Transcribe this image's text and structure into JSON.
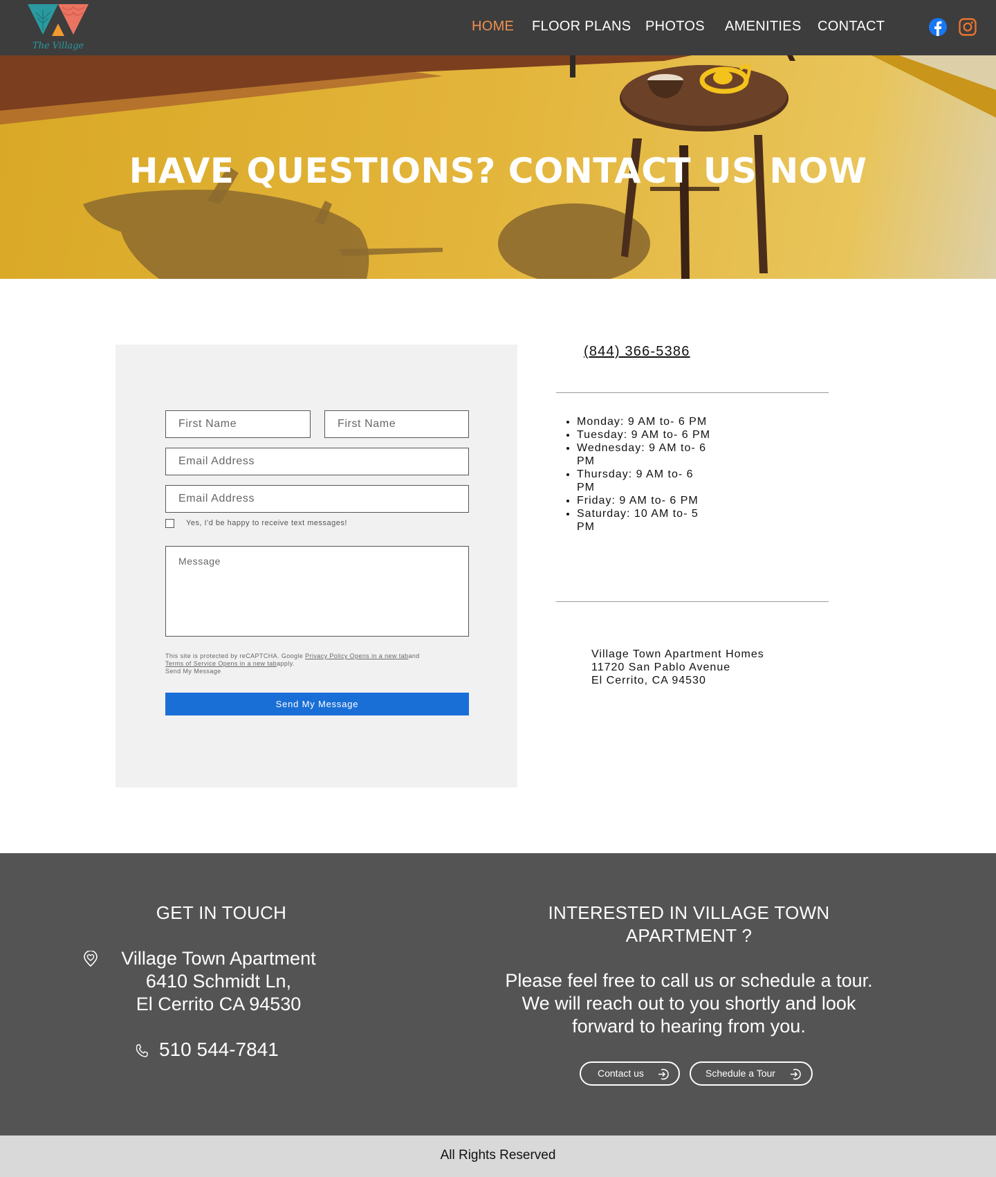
{
  "nav": {
    "logo_text": "The Village",
    "items": [
      {
        "label": "HOME",
        "active": true
      },
      {
        "label": "FLOOR PLANS"
      },
      {
        "label": "PHOTOS"
      },
      {
        "label": "AMENITIES"
      },
      {
        "label": "CONTACT"
      }
    ],
    "social": [
      "facebook-icon",
      "instagram-icon"
    ]
  },
  "hero": {
    "title": "HAVE QUESTIONS? CONTACT US NOW"
  },
  "form": {
    "first_name_placeholder": "First Name",
    "last_name_placeholder": "First Name",
    "email_placeholder": "Email Address",
    "email2_placeholder": "Email Address",
    "checkbox_label": "Yes, I'd be happy to receive text messages!",
    "message_placeholder": "Message",
    "legal_prefix": "This site is protected by reCAPTCHA. Google ",
    "legal_privacy": "Privacy Policy Opens in a new tab",
    "legal_and": "and ",
    "legal_terms": "Terms of Service Opens in a new tab",
    "legal_suffix": "apply.",
    "legal_send": "Send My Message",
    "submit_label": "Send My Message"
  },
  "contact": {
    "phone": "(844) 366-5386",
    "hours": [
      "Monday: 9 AM to- 6 PM",
      "Tuesday: 9 AM to- 6 PM",
      "Wednesday: 9 AM to- 6 PM",
      "Thursday: 9 AM to- 6 PM",
      "Friday: 9 AM to- 6 PM",
      "Saturday: 10 AM to- 5 PM"
    ],
    "address_lines": [
      "Village Town Apartment Homes",
      "11720 San Pablo Avenue",
      "El Cerrito, CA 94530"
    ]
  },
  "footer": {
    "left_heading": "GET IN TOUCH",
    "address_lines": [
      "Village Town Apartment",
      "6410 Schmidt Ln,",
      "El Cerrito CA 94530"
    ],
    "phone": "510 544-7841",
    "right_heading": "INTERESTED IN VILLAGE TOWN APARTMENT ?",
    "right_text": "Please feel free to call us or schedule a tour. We will reach out to you shortly and look forward to hearing from you.",
    "contact_btn": "Contact us",
    "tour_btn": "Schedule a Tour",
    "copyright": "All Rights Reserved"
  },
  "colors": {
    "nav_bg": "#3d3d3d",
    "nav_active": "#f0924f",
    "button_blue": "#1a6fd6",
    "footer_bg": "#545454",
    "bottom_bar": "#d9d9d9"
  }
}
